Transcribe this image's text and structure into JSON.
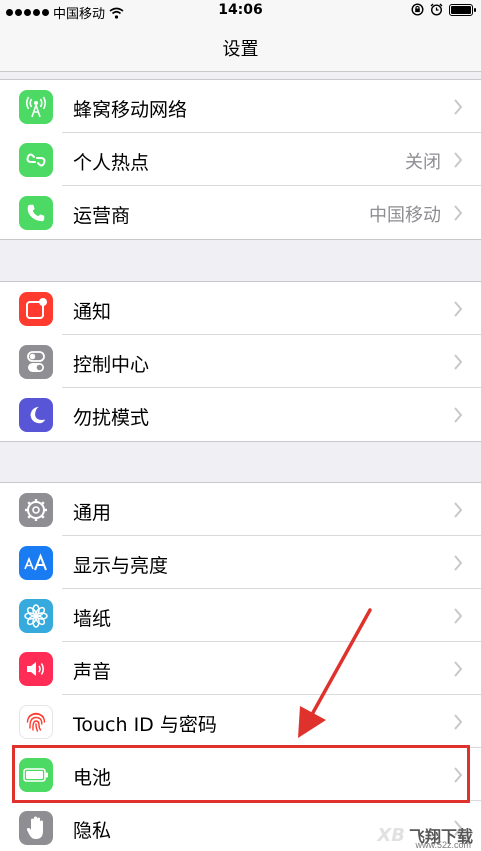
{
  "status_bar": {
    "carrier": "中国移动",
    "time": "14:06"
  },
  "nav": {
    "title": "设置"
  },
  "groups": [
    {
      "items": [
        {
          "label": "蜂窝移动网络",
          "value": "",
          "icon": "cellular-antenna-icon",
          "color": "#4cd964"
        },
        {
          "label": "个人热点",
          "value": "关闭",
          "icon": "hotspot-link-icon",
          "color": "#4cd964"
        },
        {
          "label": "运营商",
          "value": "中国移动",
          "icon": "phone-icon",
          "color": "#4cd964"
        }
      ]
    },
    {
      "items": [
        {
          "label": "通知",
          "value": "",
          "icon": "notifications-icon",
          "color": "#ff3b30"
        },
        {
          "label": "控制中心",
          "value": "",
          "icon": "control-center-toggles-icon",
          "color": "#8e8e93"
        },
        {
          "label": "勿扰模式",
          "value": "",
          "icon": "moon-icon",
          "color": "#5856d6"
        }
      ]
    },
    {
      "items": [
        {
          "label": "通用",
          "value": "",
          "icon": "gear-icon",
          "color": "#8e8e93"
        },
        {
          "label": "显示与亮度",
          "value": "",
          "icon": "text-size-aa-icon",
          "color": "#1a7cf2"
        },
        {
          "label": "墙纸",
          "value": "",
          "icon": "wallpaper-flower-icon",
          "color": "#36aadc"
        },
        {
          "label": "声音",
          "value": "",
          "icon": "speaker-icon",
          "color": "#ff2d55"
        },
        {
          "label": "Touch ID 与密码",
          "value": "",
          "icon": "fingerprint-icon",
          "color": "#ff3b30"
        },
        {
          "label": "电池",
          "value": "",
          "icon": "battery-icon",
          "color": "#4cd964"
        },
        {
          "label": "隐私",
          "value": "",
          "icon": "privacy-hand-icon",
          "color": "#8e8e93"
        }
      ]
    }
  ],
  "annotation": {
    "highlight_color": "#e0322c"
  },
  "watermark": {
    "logo": "XB",
    "text": "飞翔下载",
    "url": "www.52z.com"
  }
}
